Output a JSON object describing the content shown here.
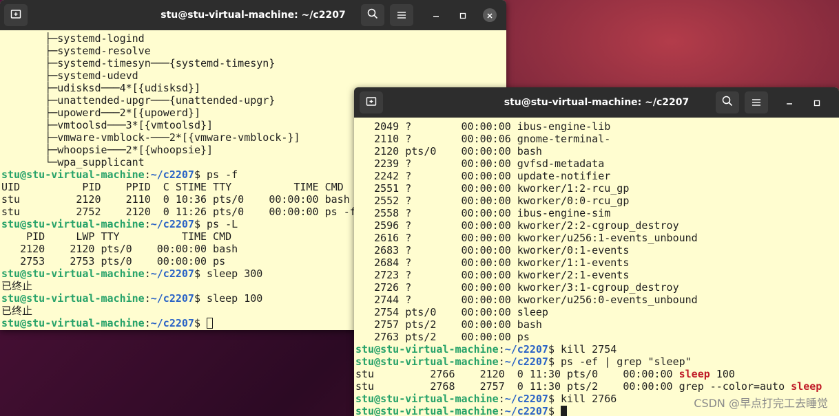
{
  "colors": {
    "prompt_user": "#26a269",
    "prompt_path": "#2a63c6",
    "grep_match": "#c01c28",
    "terminal_bg": "#fffdd0",
    "titlebar_bg": "#2d2d2d"
  },
  "icons": {
    "new_tab": "new-tab-icon",
    "search": "search-icon",
    "menu": "hamburger-menu-icon",
    "minimize": "minimize-icon",
    "maximize": "maximize-icon",
    "close": "close-icon"
  },
  "window1": {
    "title": "stu@stu-virtual-machine: ~/c2207",
    "lines": [
      {
        "t": "       ├─systemd-logind"
      },
      {
        "t": "       ├─systemd-resolve"
      },
      {
        "t": "       ├─systemd-timesyn───{systemd-timesyn}"
      },
      {
        "t": "       ├─systemd-udevd"
      },
      {
        "t": "       ├─udisksd───4*[{udisksd}]"
      },
      {
        "t": "       ├─unattended-upgr───{unattended-upgr}"
      },
      {
        "t": "       ├─upowerd───2*[{upowerd}]"
      },
      {
        "t": "       ├─vmtoolsd───3*[{vmtoolsd}]"
      },
      {
        "t": "       ├─vmware-vmblock-───2*[{vmware-vmblock-}]"
      },
      {
        "t": "       ├─whoopsie───2*[{whoopsie}]"
      },
      {
        "t": "       └─wpa_supplicant"
      },
      {
        "p": true,
        "cmd": "ps -f"
      },
      {
        "t": "UID          PID    PPID  C STIME TTY          TIME CMD"
      },
      {
        "t": "stu         2120    2110  0 10:36 pts/0    00:00:00 bash"
      },
      {
        "t": "stu         2752    2120  0 11:26 pts/0    00:00:00 ps -f"
      },
      {
        "p": true,
        "cmd": "ps -L"
      },
      {
        "t": "    PID     LWP TTY          TIME CMD"
      },
      {
        "t": "   2120    2120 pts/0    00:00:00 bash"
      },
      {
        "t": "   2753    2753 pts/0    00:00:00 ps"
      },
      {
        "p": true,
        "cmd": "sleep 300"
      },
      {
        "t": "已终止"
      },
      {
        "p": true,
        "cmd": "sleep 100"
      },
      {
        "t": "已终止"
      },
      {
        "p": true,
        "cmd": "",
        "cursor": "outline"
      }
    ]
  },
  "window2": {
    "title": "stu@stu-virtual-machine: ~/c2207",
    "lines": [
      {
        "t": "   2049 ?        00:00:00 ibus-engine-lib"
      },
      {
        "t": "   2110 ?        00:00:06 gnome-terminal-"
      },
      {
        "t": "   2120 pts/0    00:00:00 bash"
      },
      {
        "t": "   2239 ?        00:00:00 gvfsd-metadata"
      },
      {
        "t": "   2242 ?        00:00:00 update-notifier"
      },
      {
        "t": "   2551 ?        00:00:00 kworker/1:2-rcu_gp"
      },
      {
        "t": "   2552 ?        00:00:00 kworker/0:0-rcu_gp"
      },
      {
        "t": "   2558 ?        00:00:00 ibus-engine-sim"
      },
      {
        "t": "   2596 ?        00:00:00 kworker/2:2-cgroup_destroy"
      },
      {
        "t": "   2616 ?        00:00:00 kworker/u256:1-events_unbound"
      },
      {
        "t": "   2683 ?        00:00:00 kworker/0:1-events"
      },
      {
        "t": "   2684 ?        00:00:00 kworker/1:1-events"
      },
      {
        "t": "   2723 ?        00:00:00 kworker/2:1-events"
      },
      {
        "t": "   2726 ?        00:00:00 kworker/3:1-cgroup_destroy"
      },
      {
        "t": "   2744 ?        00:00:00 kworker/u256:0-events_unbound"
      },
      {
        "t": "   2754 pts/0    00:00:00 sleep"
      },
      {
        "t": "   2757 pts/2    00:00:00 bash"
      },
      {
        "t": "   2763 pts/2    00:00:00 ps"
      },
      {
        "p": true,
        "cmd": "kill 2754"
      },
      {
        "p": true,
        "cmd": "ps -ef | grep \"sleep\""
      },
      {
        "segs": [
          {
            "t": "stu         2766    2120  0 11:30 pts/0    00:00:00 "
          },
          {
            "t": "sleep",
            "c": "hl"
          },
          {
            "t": " 100"
          }
        ]
      },
      {
        "segs": [
          {
            "t": "stu         2768    2757  0 11:30 pts/2    00:00:00 grep --color=auto "
          },
          {
            "t": "sleep",
            "c": "hl"
          }
        ]
      },
      {
        "p": true,
        "cmd": "kill 2766"
      },
      {
        "p": true,
        "cmd": "",
        "cursor": "block"
      }
    ]
  },
  "prompt": {
    "user": "stu@stu-virtual-machine",
    "sep": ":",
    "path": "~/c2207",
    "end": "$ "
  },
  "watermark": "CSDN @早点打完工去睡觉"
}
